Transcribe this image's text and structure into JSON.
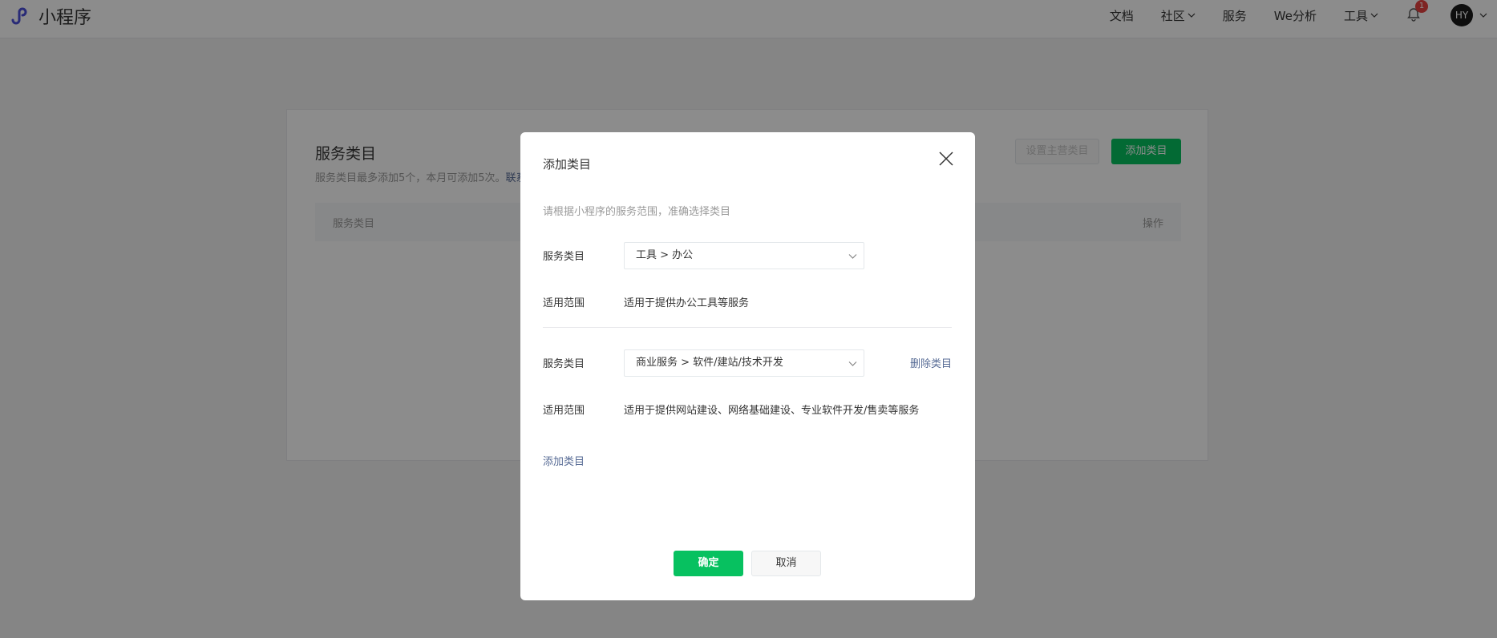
{
  "nav": {
    "brand": "小程序",
    "logo_icon": "mini-program-logo-icon",
    "links": {
      "docs": "文档",
      "community": "社区",
      "services": "服务",
      "analytics": "We分析",
      "tools": "工具"
    },
    "notification_count": "1",
    "avatar_initials": "HY"
  },
  "page": {
    "title": "服务类目",
    "desc_text": "服务类目最多添加5个，本月可添加5次。",
    "desc_link": "联系",
    "set_main_button": "设置主营类目",
    "add_button": "添加类目",
    "table_headers": {
      "category": "服务类目",
      "action": "操作"
    }
  },
  "dialog": {
    "title": "添加类目",
    "hint": "请根据小程序的服务范围，准确选择类目",
    "entries": [
      {
        "category_label": "服务类目",
        "category_value": "工具 > 办公",
        "scope_label": "适用范围",
        "scope_value": "适用于提供办公工具等服务"
      },
      {
        "category_label": "服务类目",
        "category_value": "商业服务 > 软件/建站/技术开发",
        "scope_label": "适用范围",
        "scope_value": "适用于提供网站建设、网络基础建设、专业软件开发/售卖等服务",
        "delete_link": "删除类目"
      }
    ],
    "add_link": "添加类目",
    "confirm_button": "确定",
    "cancel_button": "取消"
  },
  "colors": {
    "brand_green": "#07c160",
    "link_blue": "#576b95",
    "badge_red": "#e64340",
    "overlay": "rgba(0,0,0,0.45)"
  }
}
